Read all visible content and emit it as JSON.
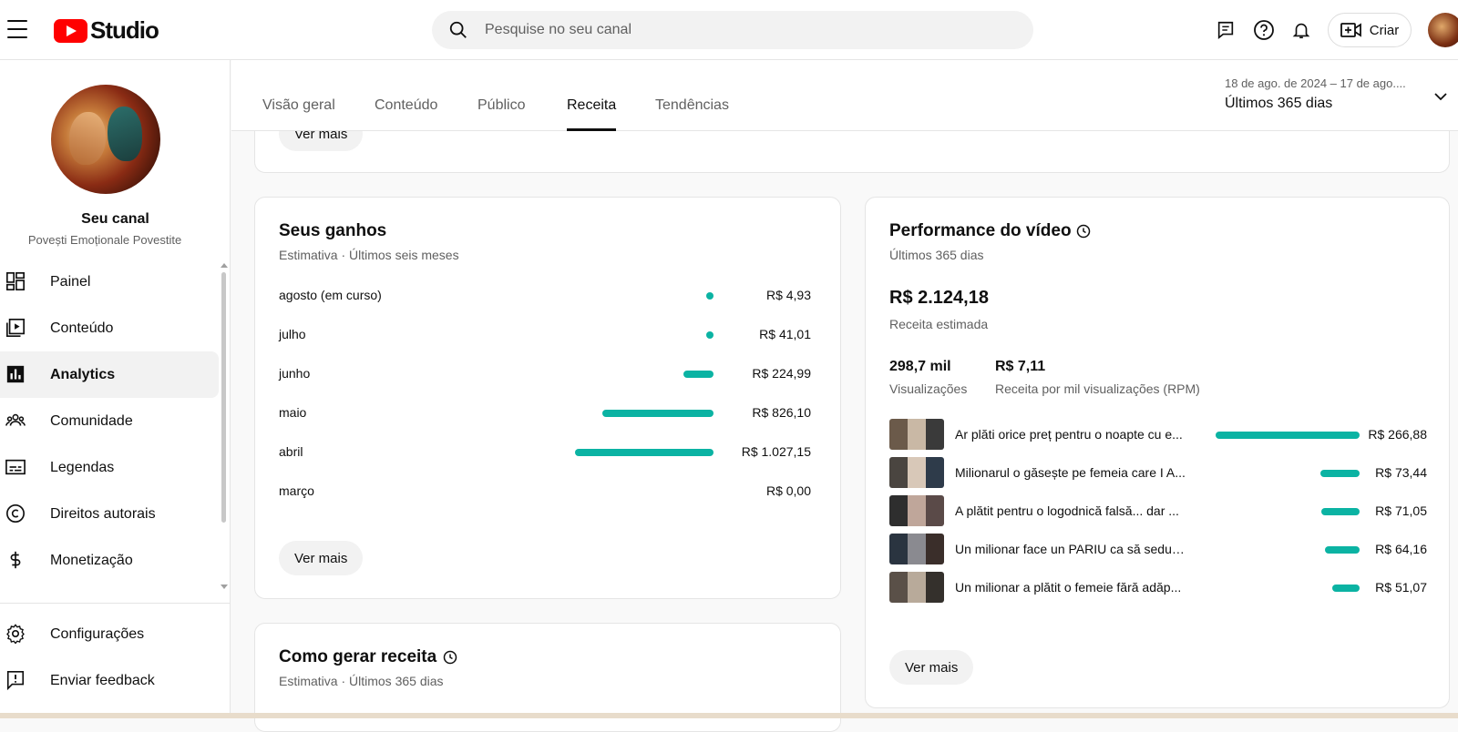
{
  "app": {
    "logo_text": "Studio"
  },
  "search": {
    "placeholder": "Pesquise no seu canal"
  },
  "header": {
    "create_label": "Criar"
  },
  "channel": {
    "title": "Seu canal",
    "name": "Povești Emoționale Povestite"
  },
  "sidebar": {
    "items": [
      {
        "label": "Painel",
        "icon": "dashboard-icon"
      },
      {
        "label": "Conteúdo",
        "icon": "content-icon"
      },
      {
        "label": "Analytics",
        "icon": "analytics-icon",
        "active": true
      },
      {
        "label": "Comunidade",
        "icon": "community-icon"
      },
      {
        "label": "Legendas",
        "icon": "subtitles-icon"
      },
      {
        "label": "Direitos autorais",
        "icon": "copyright-icon"
      },
      {
        "label": "Monetização",
        "icon": "dollar-icon"
      }
    ],
    "footer": [
      {
        "label": "Configurações",
        "icon": "gear-icon"
      },
      {
        "label": "Enviar feedback",
        "icon": "feedback-icon"
      }
    ]
  },
  "tabs": [
    {
      "label": "Visão geral"
    },
    {
      "label": "Conteúdo"
    },
    {
      "label": "Público"
    },
    {
      "label": "Receita",
      "active": true
    },
    {
      "label": "Tendências"
    }
  ],
  "date_range": {
    "range": "18 de ago. de 2024 – 17 de ago....",
    "label": "Últimos 365 dias"
  },
  "top_card": {
    "more_label": "Ver mais"
  },
  "earnings": {
    "title": "Seus ganhos",
    "subtitle": "Estimativa · Últimos seis meses",
    "more_label": "Ver mais",
    "accent_color": "#0bb3a3",
    "rows": [
      {
        "month": "agosto (em curso)",
        "value": "R$ 4,93",
        "amount": 4.93
      },
      {
        "month": "julho",
        "value": "R$ 41,01",
        "amount": 41.01
      },
      {
        "month": "junho",
        "value": "R$ 224,99",
        "amount": 224.99
      },
      {
        "month": "maio",
        "value": "R$ 826,10",
        "amount": 826.1
      },
      {
        "month": "abril",
        "value": "R$ 1.027,15",
        "amount": 1027.15
      },
      {
        "month": "março",
        "value": "R$ 0,00",
        "amount": 0
      }
    ]
  },
  "how_to_earn": {
    "title": "Como gerar receita",
    "subtitle": "Estimativa · Últimos 365 dias"
  },
  "performance": {
    "title": "Performance do vídeo",
    "subtitle": "Últimos 365 dias",
    "revenue": "R$ 2.124,18",
    "revenue_label": "Receita estimada",
    "views": "298,7 mil",
    "views_label": "Visualizações",
    "rpm": "R$ 7,11",
    "rpm_label": "Receita por mil visualizações (RPM)",
    "more_label": "Ver mais",
    "videos": [
      {
        "title": "Ar plăti orice preț pentru o noapte cu e...",
        "value": "R$ 266,88",
        "amount": 266.88
      },
      {
        "title": "Milionarul o găsește pe femeia care I A...",
        "value": "R$ 73,44",
        "amount": 73.44
      },
      {
        "title": "A plătit pentru o logodnică falsă... dar ...",
        "value": "R$ 71,05",
        "amount": 71.05
      },
      {
        "title": "Un milionar face un PARIU ca să seduc...",
        "value": "R$ 64,16",
        "amount": 64.16
      },
      {
        "title": "Un milionar a plătit o femeie fără adăp...",
        "value": "R$ 51,07",
        "amount": 51.07
      }
    ]
  }
}
